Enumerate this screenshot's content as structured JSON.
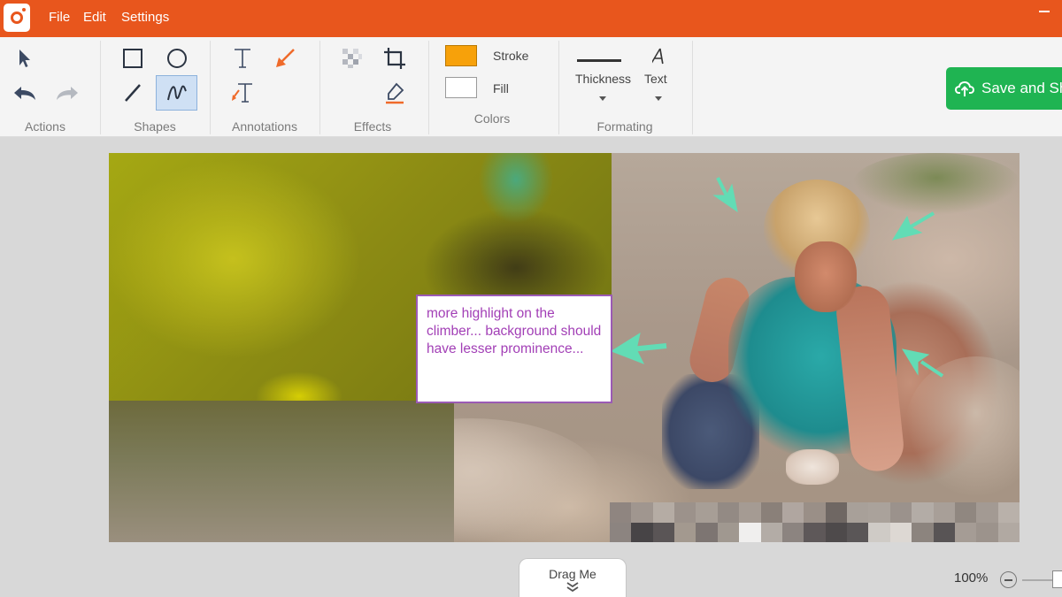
{
  "menu": {
    "file": "File",
    "edit": "Edit",
    "settings": "Settings"
  },
  "toolbar": {
    "groups": {
      "actions": "Actions",
      "shapes": "Shapes",
      "annotations": "Annotations",
      "effects": "Effects",
      "colors": "Colors",
      "formatting": "Formating"
    },
    "colors": {
      "stroke_label": "Stroke",
      "fill_label": "Fill",
      "stroke_color": "#f7a10a",
      "fill_color": "#ffffff"
    },
    "formatting": {
      "thickness_label": "Thickness",
      "text_label": "Text"
    },
    "active_tool": "freehand-tool",
    "save_label": "Save and Sh"
  },
  "canvas": {
    "annotation_text": "more highlight on the climber... background should have lesser prominence...",
    "arrow_color": "#62dcb5"
  },
  "footer": {
    "drag_label": "Drag Me",
    "zoom_level": "100%"
  },
  "icons": [
    "app-logo-icon",
    "pointer-icon",
    "undo-icon",
    "redo-icon",
    "rectangle-icon",
    "ellipse-icon",
    "line-icon",
    "freehand-icon",
    "text-icon",
    "arrow-icon",
    "text-arrow-icon",
    "pixelate-icon",
    "crop-icon",
    "highlighter-icon",
    "cloud-upload-icon",
    "chevron-double-down-icon"
  ]
}
